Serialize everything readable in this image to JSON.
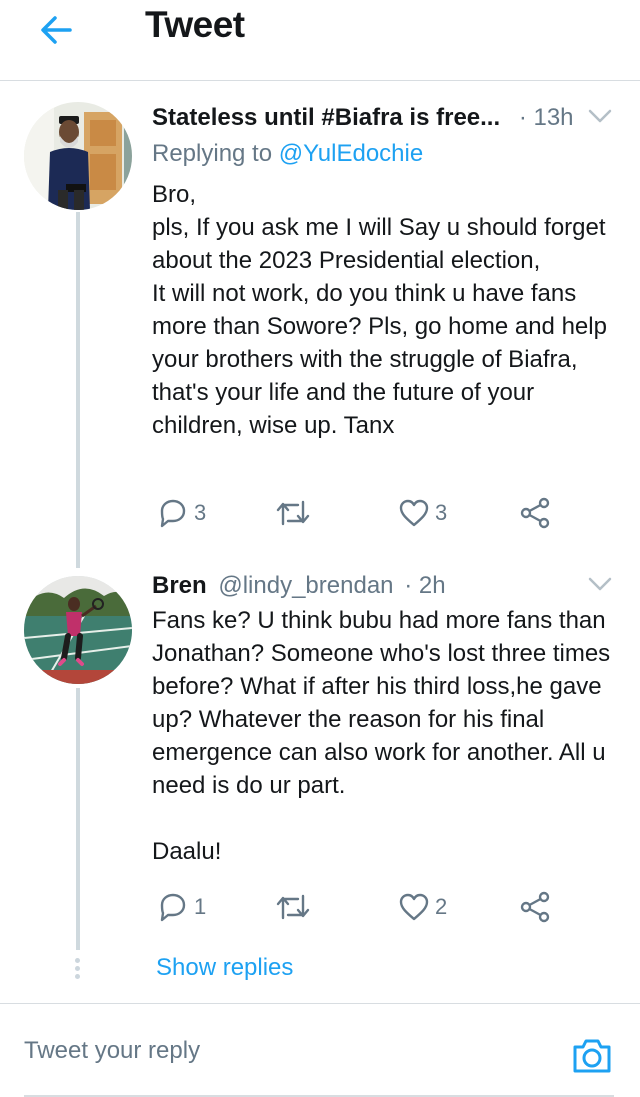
{
  "header": {
    "title": "Tweet"
  },
  "tweets": [
    {
      "name": "Stateless until #Biafra is free...",
      "handle": "",
      "time": "· 13h",
      "replying_prefix": "Replying to ",
      "replying_to": "@YulEdochie",
      "text": "Bro,\npls, If you ask me I will Say u should forget about the 2023 Presidential election,\nIt will not work, do you think u have fans more than Sowore? Pls, go home and help your brothers with the struggle of Biafra, that's your life and the future of your children, wise up. Tanx",
      "replies": "3",
      "retweets": "",
      "likes": "3"
    },
    {
      "name": "Bren",
      "handle": "@lindy_brendan",
      "time": "· 2h",
      "text": "Fans ke? U think bubu had more fans than Jonathan? Someone who's lost three times before? What if after his third loss,he gave up? Whatever the reason for his final emergence can also work for another. All u need is do ur part.\n\nDaalu!",
      "replies": "1",
      "retweets": "",
      "likes": "2"
    }
  ],
  "show_replies": "Show replies",
  "compose": {
    "placeholder": "Tweet your reply"
  },
  "colors": {
    "accent": "#1da1f2",
    "muted": "#657786",
    "text": "#14171a",
    "divider": "#d8dde1"
  }
}
